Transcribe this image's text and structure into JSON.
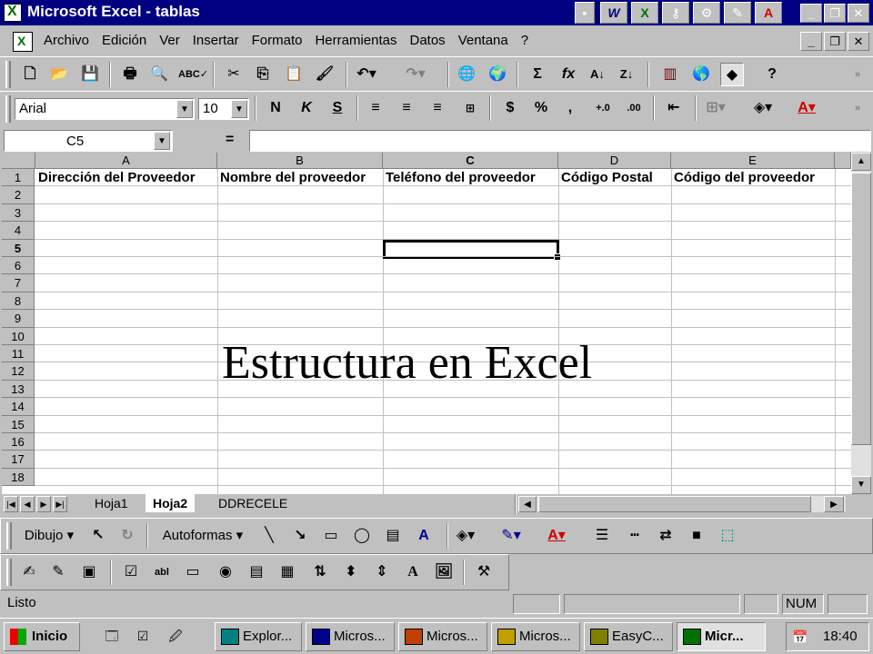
{
  "window": {
    "title": "Microsoft Excel - tablas"
  },
  "menu": [
    "Archivo",
    "Edición",
    "Ver",
    "Insertar",
    "Formato",
    "Herramientas",
    "Datos",
    "Ventana",
    "?"
  ],
  "formatting": {
    "font": "Arial",
    "size": "10"
  },
  "formula_bar": {
    "cell_ref": "C5",
    "equals": "=",
    "value": ""
  },
  "columns": [
    "A",
    "B",
    "C",
    "D",
    "E"
  ],
  "headers": [
    "Dirección del Proveedor",
    "Nombre del proveedor",
    "Teléfono del proveedor",
    "Código Postal",
    "Código del proveedor"
  ],
  "rows": [
    "1",
    "2",
    "3",
    "4",
    "5",
    "6",
    "7",
    "8",
    "9",
    "10",
    "11",
    "12",
    "13",
    "14",
    "15",
    "16",
    "17",
    "18"
  ],
  "caption": "Estructura en Excel",
  "sheets": [
    "Hoja1",
    "Hoja2",
    "DDRECELE"
  ],
  "active_sheet": "Hoja2",
  "drawing": {
    "draw_label": "Dibujo",
    "autoshapes_label": "Autoformas"
  },
  "status": {
    "text": "Listo",
    "num": "NUM"
  },
  "taskbar": {
    "start": "Inicio",
    "tasks": [
      "Explor...",
      "Micros...",
      "Micros...",
      "Micros...",
      "EasyC...",
      "Micr..."
    ],
    "clock": "18:40"
  },
  "icons": {
    "toolbar": [
      "new-icon",
      "open-icon",
      "save-icon",
      "print-icon",
      "preview-icon",
      "spelling-icon",
      "cut-icon",
      "copy-icon",
      "paste-icon",
      "format-painter-icon",
      "undo-icon",
      "redo-icon",
      "hyperlink-icon",
      "web-icon",
      "autosum-icon",
      "function-icon",
      "sort-asc-icon",
      "sort-desc-icon",
      "chart-icon",
      "map-icon",
      "drawing-icon",
      "help-icon"
    ]
  }
}
